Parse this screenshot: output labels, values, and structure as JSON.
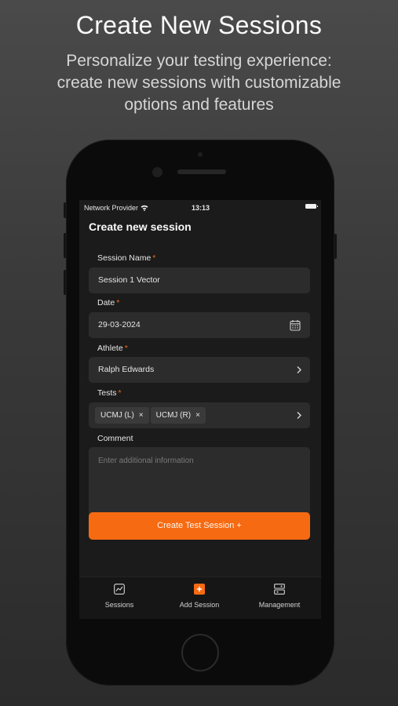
{
  "hero": {
    "title": "Create New Sessions",
    "subtitle_lines": [
      "Personalize your testing experience:",
      "create new sessions with customizable",
      "options and features"
    ]
  },
  "status_bar": {
    "provider": "Network Provider",
    "time": "13:13"
  },
  "form": {
    "title": "Create new session",
    "session_name": {
      "label": "Session Name",
      "required": "*",
      "value": "Session 1 Vector"
    },
    "date": {
      "label": "Date",
      "required": "*",
      "value": "29-03-2024"
    },
    "athlete": {
      "label": "Athlete",
      "required": "*",
      "value": "Ralph Edwards"
    },
    "tests": {
      "label": "Tests",
      "required": "*",
      "chips": [
        "UCMJ (L)",
        "UCMJ (R)"
      ],
      "remove_glyph": "×"
    },
    "comment": {
      "label": "Comment",
      "placeholder": "Enter additional information"
    },
    "submit_label": "Create Test Session +"
  },
  "tabbar": {
    "items": [
      {
        "label": "Sessions",
        "icon": "chart-icon"
      },
      {
        "label": "Add Session",
        "icon": "plus-square-icon"
      },
      {
        "label": "Management",
        "icon": "management-icon"
      }
    ]
  },
  "colors": {
    "accent": "#f66a12",
    "field_bg": "#2c2c2c",
    "screen_bg": "#1b1b1b"
  }
}
